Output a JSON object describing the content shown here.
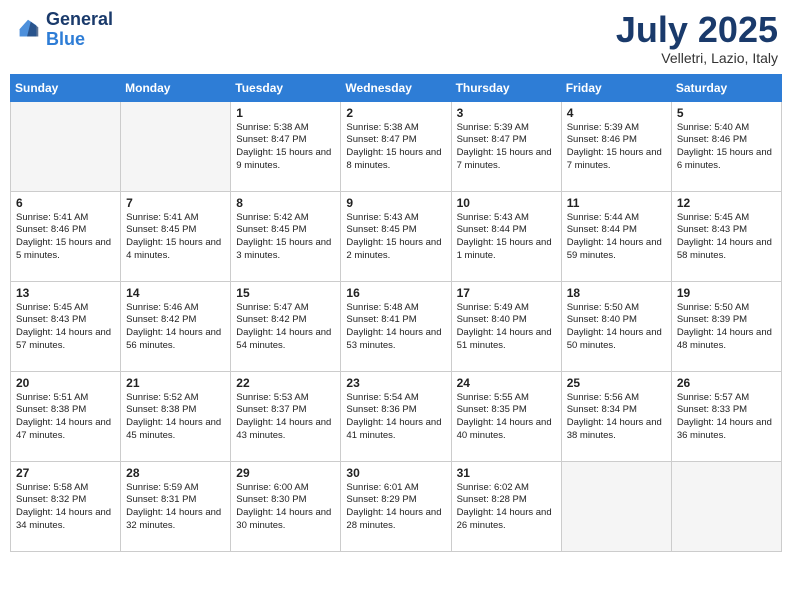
{
  "header": {
    "logo_line1": "General",
    "logo_line2": "Blue",
    "month": "July 2025",
    "location": "Velletri, Lazio, Italy"
  },
  "days_of_week": [
    "Sunday",
    "Monday",
    "Tuesday",
    "Wednesday",
    "Thursday",
    "Friday",
    "Saturday"
  ],
  "weeks": [
    [
      {
        "day": "",
        "empty": true
      },
      {
        "day": "",
        "empty": true
      },
      {
        "day": "1",
        "sunrise": "Sunrise: 5:38 AM",
        "sunset": "Sunset: 8:47 PM",
        "daylight": "Daylight: 15 hours and 9 minutes."
      },
      {
        "day": "2",
        "sunrise": "Sunrise: 5:38 AM",
        "sunset": "Sunset: 8:47 PM",
        "daylight": "Daylight: 15 hours and 8 minutes."
      },
      {
        "day": "3",
        "sunrise": "Sunrise: 5:39 AM",
        "sunset": "Sunset: 8:47 PM",
        "daylight": "Daylight: 15 hours and 7 minutes."
      },
      {
        "day": "4",
        "sunrise": "Sunrise: 5:39 AM",
        "sunset": "Sunset: 8:46 PM",
        "daylight": "Daylight: 15 hours and 7 minutes."
      },
      {
        "day": "5",
        "sunrise": "Sunrise: 5:40 AM",
        "sunset": "Sunset: 8:46 PM",
        "daylight": "Daylight: 15 hours and 6 minutes."
      }
    ],
    [
      {
        "day": "6",
        "sunrise": "Sunrise: 5:41 AM",
        "sunset": "Sunset: 8:46 PM",
        "daylight": "Daylight: 15 hours and 5 minutes."
      },
      {
        "day": "7",
        "sunrise": "Sunrise: 5:41 AM",
        "sunset": "Sunset: 8:45 PM",
        "daylight": "Daylight: 15 hours and 4 minutes."
      },
      {
        "day": "8",
        "sunrise": "Sunrise: 5:42 AM",
        "sunset": "Sunset: 8:45 PM",
        "daylight": "Daylight: 15 hours and 3 minutes."
      },
      {
        "day": "9",
        "sunrise": "Sunrise: 5:43 AM",
        "sunset": "Sunset: 8:45 PM",
        "daylight": "Daylight: 15 hours and 2 minutes."
      },
      {
        "day": "10",
        "sunrise": "Sunrise: 5:43 AM",
        "sunset": "Sunset: 8:44 PM",
        "daylight": "Daylight: 15 hours and 1 minute."
      },
      {
        "day": "11",
        "sunrise": "Sunrise: 5:44 AM",
        "sunset": "Sunset: 8:44 PM",
        "daylight": "Daylight: 14 hours and 59 minutes."
      },
      {
        "day": "12",
        "sunrise": "Sunrise: 5:45 AM",
        "sunset": "Sunset: 8:43 PM",
        "daylight": "Daylight: 14 hours and 58 minutes."
      }
    ],
    [
      {
        "day": "13",
        "sunrise": "Sunrise: 5:45 AM",
        "sunset": "Sunset: 8:43 PM",
        "daylight": "Daylight: 14 hours and 57 minutes."
      },
      {
        "day": "14",
        "sunrise": "Sunrise: 5:46 AM",
        "sunset": "Sunset: 8:42 PM",
        "daylight": "Daylight: 14 hours and 56 minutes."
      },
      {
        "day": "15",
        "sunrise": "Sunrise: 5:47 AM",
        "sunset": "Sunset: 8:42 PM",
        "daylight": "Daylight: 14 hours and 54 minutes."
      },
      {
        "day": "16",
        "sunrise": "Sunrise: 5:48 AM",
        "sunset": "Sunset: 8:41 PM",
        "daylight": "Daylight: 14 hours and 53 minutes."
      },
      {
        "day": "17",
        "sunrise": "Sunrise: 5:49 AM",
        "sunset": "Sunset: 8:40 PM",
        "daylight": "Daylight: 14 hours and 51 minutes."
      },
      {
        "day": "18",
        "sunrise": "Sunrise: 5:50 AM",
        "sunset": "Sunset: 8:40 PM",
        "daylight": "Daylight: 14 hours and 50 minutes."
      },
      {
        "day": "19",
        "sunrise": "Sunrise: 5:50 AM",
        "sunset": "Sunset: 8:39 PM",
        "daylight": "Daylight: 14 hours and 48 minutes."
      }
    ],
    [
      {
        "day": "20",
        "sunrise": "Sunrise: 5:51 AM",
        "sunset": "Sunset: 8:38 PM",
        "daylight": "Daylight: 14 hours and 47 minutes."
      },
      {
        "day": "21",
        "sunrise": "Sunrise: 5:52 AM",
        "sunset": "Sunset: 8:38 PM",
        "daylight": "Daylight: 14 hours and 45 minutes."
      },
      {
        "day": "22",
        "sunrise": "Sunrise: 5:53 AM",
        "sunset": "Sunset: 8:37 PM",
        "daylight": "Daylight: 14 hours and 43 minutes."
      },
      {
        "day": "23",
        "sunrise": "Sunrise: 5:54 AM",
        "sunset": "Sunset: 8:36 PM",
        "daylight": "Daylight: 14 hours and 41 minutes."
      },
      {
        "day": "24",
        "sunrise": "Sunrise: 5:55 AM",
        "sunset": "Sunset: 8:35 PM",
        "daylight": "Daylight: 14 hours and 40 minutes."
      },
      {
        "day": "25",
        "sunrise": "Sunrise: 5:56 AM",
        "sunset": "Sunset: 8:34 PM",
        "daylight": "Daylight: 14 hours and 38 minutes."
      },
      {
        "day": "26",
        "sunrise": "Sunrise: 5:57 AM",
        "sunset": "Sunset: 8:33 PM",
        "daylight": "Daylight: 14 hours and 36 minutes."
      }
    ],
    [
      {
        "day": "27",
        "sunrise": "Sunrise: 5:58 AM",
        "sunset": "Sunset: 8:32 PM",
        "daylight": "Daylight: 14 hours and 34 minutes."
      },
      {
        "day": "28",
        "sunrise": "Sunrise: 5:59 AM",
        "sunset": "Sunset: 8:31 PM",
        "daylight": "Daylight: 14 hours and 32 minutes."
      },
      {
        "day": "29",
        "sunrise": "Sunrise: 6:00 AM",
        "sunset": "Sunset: 8:30 PM",
        "daylight": "Daylight: 14 hours and 30 minutes."
      },
      {
        "day": "30",
        "sunrise": "Sunrise: 6:01 AM",
        "sunset": "Sunset: 8:29 PM",
        "daylight": "Daylight: 14 hours and 28 minutes."
      },
      {
        "day": "31",
        "sunrise": "Sunrise: 6:02 AM",
        "sunset": "Sunset: 8:28 PM",
        "daylight": "Daylight: 14 hours and 26 minutes."
      },
      {
        "day": "",
        "empty": true
      },
      {
        "day": "",
        "empty": true
      }
    ]
  ]
}
